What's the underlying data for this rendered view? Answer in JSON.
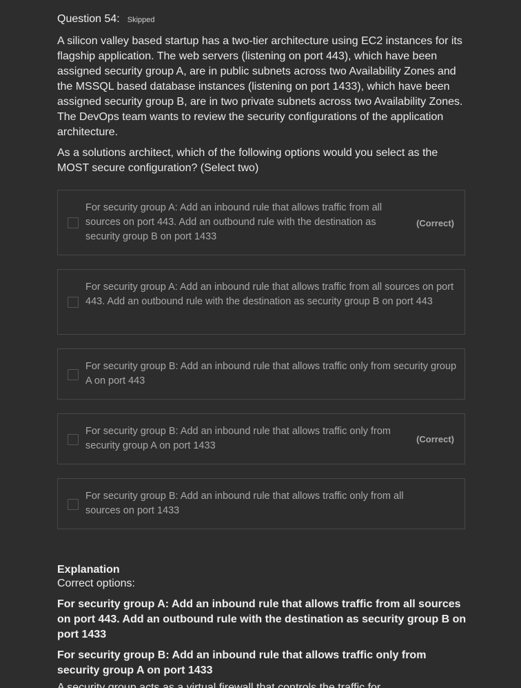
{
  "question": {
    "title": "Question 54:",
    "status": "Skipped",
    "text": "A silicon valley based startup has a two-tier architecture using EC2 instances for its flagship application. The web servers (listening on port 443), which have been assigned security group A, are in public subnets across two Availability Zones and the MSSQL based database instances (listening on port 1433), which have been assigned security group B, are in two private subnets across two Availability Zones. The DevOps team wants to review the security configurations of the application architecture.",
    "prompt": "As a solutions architect, which of the following options would you select as the MOST secure configuration? (Select two)"
  },
  "options": [
    {
      "text": "For security group A: Add an inbound rule that allows traffic from all sources on port 443. Add an outbound rule with the destination as security group B on port 1433",
      "tag": "(Correct)"
    },
    {
      "text": "For security group A: Add an inbound rule that allows traffic from all sources on port 443. Add an outbound rule with the destination as security group B on port 443",
      "tag": ""
    },
    {
      "text": "For security group B: Add an inbound rule that allows traffic only from security group A on port 443",
      "tag": ""
    },
    {
      "text": "For security group B: Add an inbound rule that allows traffic only from security group A on port 1433",
      "tag": "(Correct)"
    },
    {
      "text": "For security group B: Add an inbound rule that allows traffic only from all sources on port 1433",
      "tag": ""
    }
  ],
  "explanation": {
    "title": "Explanation",
    "subtitle": "Correct options:",
    "correct_1": "For security group A: Add an inbound rule that allows traffic from all sources on port 443. Add an outbound rule with the destination as security group B on port 1433",
    "correct_2": "For security group B: Add an inbound rule that allows traffic only from security group A on port 1433",
    "cut_line": "A security group acts as a virtual firewall that controls the traffic for"
  }
}
